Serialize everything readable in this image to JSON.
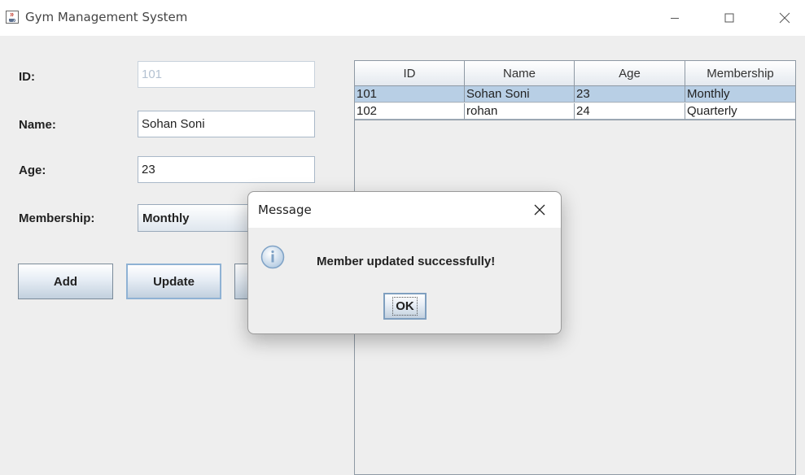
{
  "window": {
    "title": "Gym Management System"
  },
  "form": {
    "id_label": "ID:",
    "id_value": "101",
    "name_label": "Name:",
    "name_value": "Sohan Soni",
    "age_label": "Age:",
    "age_value": "23",
    "membership_label": "Membership:",
    "membership_value": "Monthly"
  },
  "buttons": {
    "add": "Add",
    "update": "Update"
  },
  "table": {
    "columns": [
      "ID",
      "Name",
      "Age",
      "Membership"
    ],
    "rows": [
      [
        "101",
        "Sohan Soni",
        "23",
        "Monthly"
      ],
      [
        "102",
        "rohan",
        "24",
        "Quarterly"
      ]
    ]
  },
  "dialog": {
    "title": "Message",
    "message": "Member updated successfully!",
    "ok_label": "OK"
  },
  "icons": {
    "app": "java-coffee-icon",
    "dialog": "info-icon"
  },
  "colors": {
    "selection": "#b8cfe5",
    "background": "#eeeeee",
    "info_icon": "#7fa2c6"
  }
}
